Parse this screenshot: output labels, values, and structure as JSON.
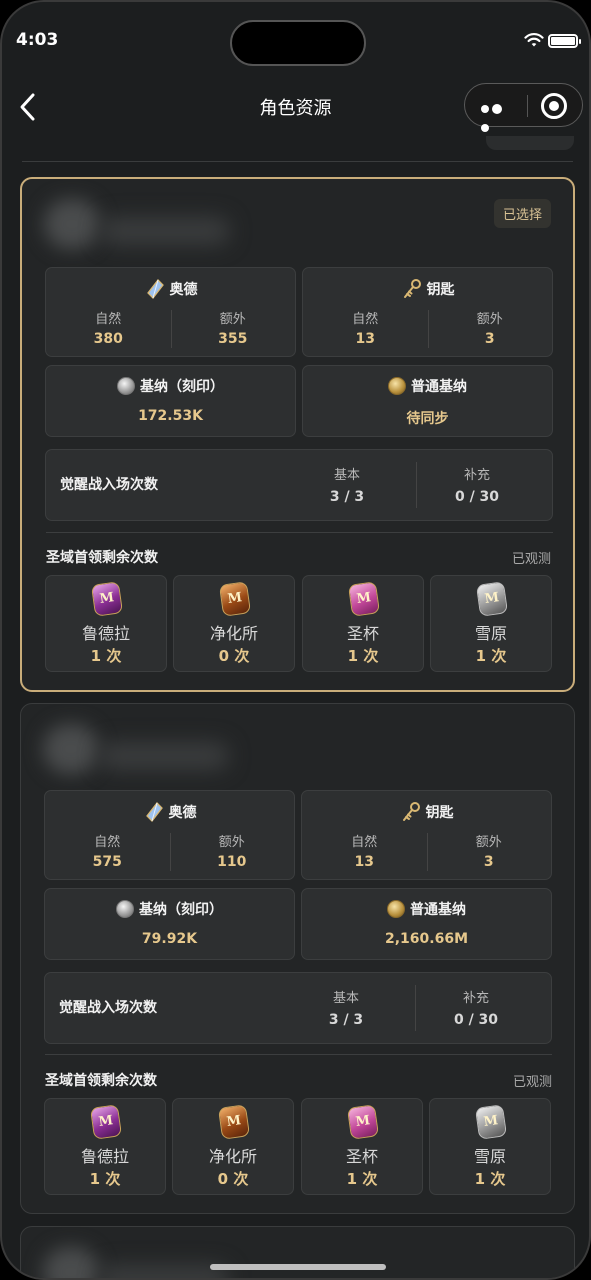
{
  "status_bar": {
    "time": "4:03"
  },
  "nav": {
    "title": "角色资源"
  },
  "cards": [
    {
      "selected_badge": "已选择",
      "aode": {
        "title": "奥德",
        "natural_label": "自然",
        "natural": "380",
        "extra_label": "额外",
        "extra": "355"
      },
      "key": {
        "title": "钥匙",
        "natural_label": "自然",
        "natural": "13",
        "extra_label": "额外",
        "extra": "3"
      },
      "gina_engraved": {
        "title": "基纳（刻印）",
        "value": "172.53K"
      },
      "gina_normal": {
        "title": "普通基纳",
        "value": "待同步"
      },
      "awakening": {
        "title": "觉醒战入场次数",
        "basic_label": "基本",
        "basic": "3 / 3",
        "supp_label": "补充",
        "supp": "0 / 30"
      },
      "boss_section": {
        "title": "圣域首领剩余次数",
        "status": "已观测"
      },
      "bosses": [
        {
          "name": "鲁德拉",
          "count": "1 次"
        },
        {
          "name": "净化所",
          "count": "0 次"
        },
        {
          "name": "圣杯",
          "count": "1 次"
        },
        {
          "name": "雪原",
          "count": "1 次"
        }
      ]
    },
    {
      "aode": {
        "title": "奥德",
        "natural_label": "自然",
        "natural": "575",
        "extra_label": "额外",
        "extra": "110"
      },
      "key": {
        "title": "钥匙",
        "natural_label": "自然",
        "natural": "13",
        "extra_label": "额外",
        "extra": "3"
      },
      "gina_engraved": {
        "title": "基纳（刻印）",
        "value": "79.92K"
      },
      "gina_normal": {
        "title": "普通基纳",
        "value": "2,160.66M"
      },
      "awakening": {
        "title": "觉醒战入场次数",
        "basic_label": "基本",
        "basic": "3 / 3",
        "supp_label": "补充",
        "supp": "0 / 30"
      },
      "boss_section": {
        "title": "圣域首领剩余次数",
        "status": "已观测"
      },
      "bosses": [
        {
          "name": "鲁德拉",
          "count": "1 次"
        },
        {
          "name": "净化所",
          "count": "0 次"
        },
        {
          "name": "圣杯",
          "count": "1 次"
        },
        {
          "name": "雪原",
          "count": "1 次"
        }
      ]
    }
  ],
  "colors": {
    "accent_gold": "#e6c88d",
    "selected_border": "#c9ad7a",
    "background": "#1c1e1f"
  }
}
